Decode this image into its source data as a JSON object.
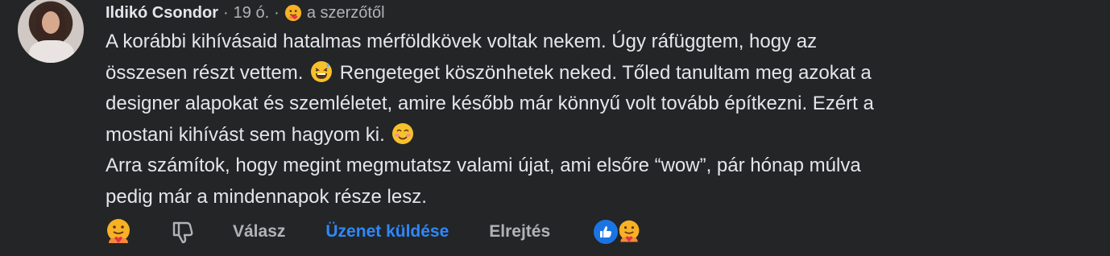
{
  "comment": {
    "author": "Ildikó Csondor",
    "separator": "·",
    "time": "19 ó.",
    "author_badge": "a szerzőtől",
    "line1": "A korábbi kihívásaid hatalmas mérföldkövek voltak nekem. Úgy ráfüggtem, hogy az",
    "line2a": "összesen részt vettem.",
    "line2b": "Rengeteget köszönhetek neked. Tőled tanultam meg azokat a",
    "line3": "designer alapokat és szemléletet, amire később már könnyű volt tovább építkezni. Ezért a",
    "line4": "mostani kihívást sem hagyom ki.",
    "line5": "Arra számítok, hogy megint megmutatsz valami újat, ami elsőre “wow”, pár hónap múlva",
    "line6": "pedig már a mindennapok része lesz."
  },
  "actions": {
    "reply": "Válasz",
    "send_message": "Üzenet küldése",
    "hide": "Elrejtés"
  },
  "icons": {
    "react": "care-reaction-icon",
    "dislike": "thumbs-down-icon",
    "summary": [
      "like-reaction-icon",
      "care-reaction-icon"
    ],
    "inline_emojis": [
      "grinning-sweat-emoji",
      "smiling-blush-emoji"
    ]
  },
  "colors": {
    "background": "#242526",
    "text": "#e4e6eb",
    "muted": "#b0b3b8",
    "link": "#2d88ff",
    "like_blue": "#1b74e4"
  }
}
